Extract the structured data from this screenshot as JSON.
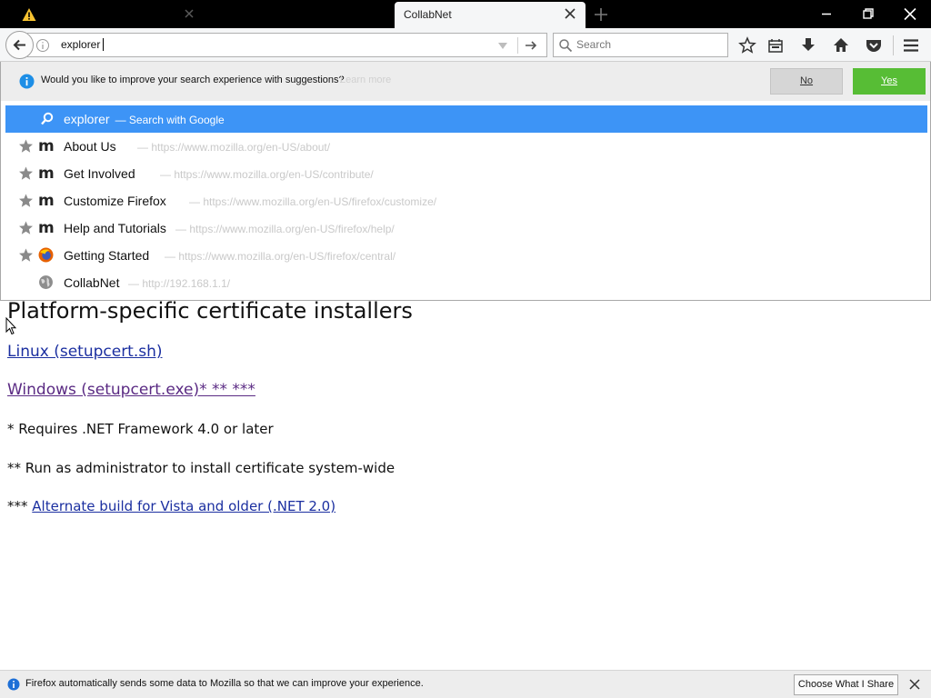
{
  "tabs": [
    {
      "title": "",
      "icon": "warning-icon"
    },
    {
      "title": "",
      "icon": "firefox-icon"
    },
    {
      "title": "CollabNet",
      "icon": "none",
      "active": true
    }
  ],
  "urlbar": {
    "value": "explorer"
  },
  "searchbar": {
    "placeholder": "Search"
  },
  "suggestion_prompt": {
    "text": "Would you like to improve your search experience with suggestions?",
    "learn_more": "Learn more",
    "no_label": "No",
    "yes_label": "Yes"
  },
  "autocomplete": {
    "selected": {
      "title": "explorer",
      "action": "— Search with Google"
    },
    "items": [
      {
        "title": "About Us",
        "url": "— https://www.mozilla.org/en-US/about/",
        "icon": "mozilla-m-icon"
      },
      {
        "title": "Get Involved",
        "url": "— https://www.mozilla.org/en-US/contribute/",
        "icon": "mozilla-m-icon"
      },
      {
        "title": "Customize Firefox",
        "url": "— https://www.mozilla.org/en-US/firefox/customize/",
        "icon": "mozilla-m-icon"
      },
      {
        "title": "Help and Tutorials",
        "url": "— https://www.mozilla.org/en-US/firefox/help/",
        "icon": "mozilla-m-icon"
      },
      {
        "title": "Getting Started",
        "url": "— https://www.mozilla.org/en-US/firefox/central/",
        "icon": "firefox-icon"
      },
      {
        "title": "CollabNet",
        "url": "— http://192.168.1.1/",
        "icon": "globe-icon"
      }
    ]
  },
  "page": {
    "title": "Platform-specific certificate installers",
    "linux_link": "Linux (setupcert.sh)",
    "windows_link": "Windows (setupcert.exe)* ** ***",
    "note1": "* Requires .NET Framework 4.0 or later",
    "note2": "** Run as administrator to install certificate system-wide",
    "note3_prefix": "*** ",
    "note3_link": "Alternate build for Vista and older (.NET 2.0)"
  },
  "notification": {
    "text": "Firefox automatically sends some data to Mozilla so that we can improve your experience.",
    "button": "Choose What I Share"
  },
  "colors": {
    "selection": "#3d94f6",
    "yes_button": "#57bd35",
    "link": "#1b2fa0",
    "visited_link": "#5a2a83"
  }
}
